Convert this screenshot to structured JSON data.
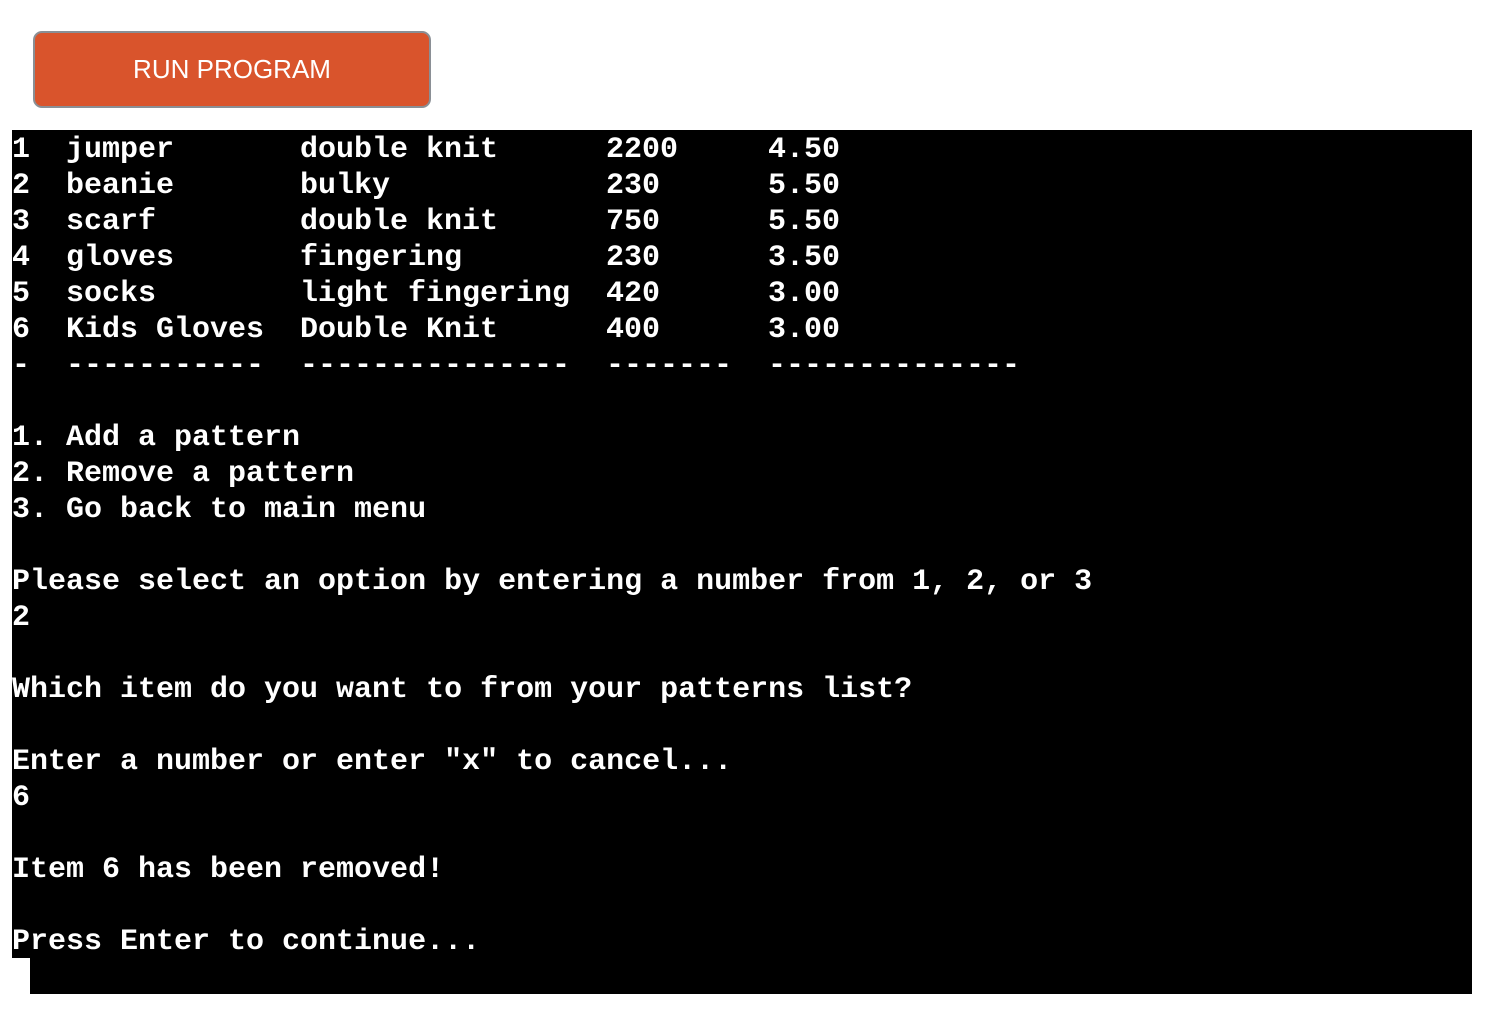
{
  "run_button": {
    "label": "RUN PROGRAM"
  },
  "table": {
    "rows": [
      {
        "num": "1",
        "name": "jumper",
        "weight": "double knit",
        "yards": "2200",
        "price": "4.50"
      },
      {
        "num": "2",
        "name": "beanie",
        "weight": "bulky",
        "yards": "230",
        "price": "5.50"
      },
      {
        "num": "3",
        "name": "scarf",
        "weight": "double knit",
        "yards": "750",
        "price": "5.50"
      },
      {
        "num": "4",
        "name": "gloves",
        "weight": "fingering",
        "yards": "230",
        "price": "3.50"
      },
      {
        "num": "5",
        "name": "socks",
        "weight": "light fingering",
        "yards": "420",
        "price": "3.00"
      },
      {
        "num": "6",
        "name": "Kids Gloves",
        "weight": "Double Knit",
        "yards": "400",
        "price": "3.00"
      }
    ],
    "separator": {
      "num": "-",
      "name": "-----------",
      "weight": "---------------",
      "yards": "-------",
      "price": "--------------"
    }
  },
  "menu": {
    "option1": "1. Add a pattern",
    "option2": "2. Remove a pattern",
    "option3": "3. Go back to main menu"
  },
  "prompt_select": "Please select an option by entering a number from 1, 2, or 3",
  "input_select": "2",
  "prompt_which": "Which item do you want to from your patterns list?",
  "prompt_enter": "Enter a number or enter \"x\" to cancel...",
  "input_item": "6",
  "message_removed": "Item 6 has been removed!",
  "prompt_continue": "Press Enter to continue..."
}
